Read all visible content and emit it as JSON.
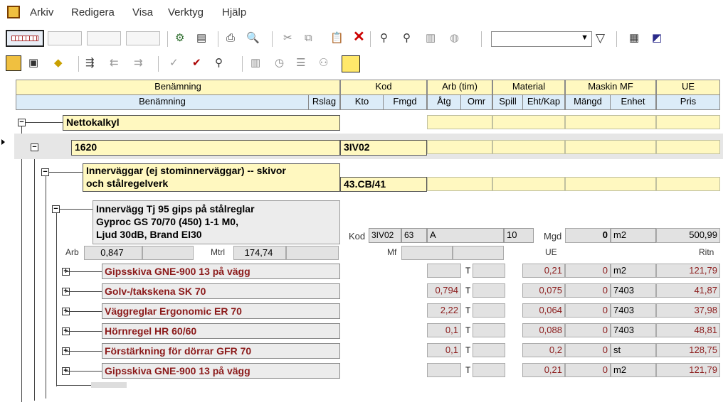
{
  "menu": {
    "items": [
      "Arkiv",
      "Redigera",
      "Visa",
      "Verktyg",
      "Hjälp"
    ]
  },
  "toolbar": {
    "combo_value": ""
  },
  "grid": {
    "group_headers": {
      "benamning": "Benämning",
      "kod": "Kod",
      "arb": "Arb (tim)",
      "material": "Material",
      "maskin": "Maskin MF",
      "ue": "UE"
    },
    "col_headers": {
      "benamning": "Benämning",
      "rslag": "Rslag",
      "kto": "Kto",
      "fmgd": "Fmgd",
      "atg": "Åtg",
      "omr": "Omr",
      "spill": "Spill",
      "eht": "Eht/Kap",
      "mangd": "Mängd",
      "enhet": "Enhet",
      "pris": "Pris"
    }
  },
  "tree": {
    "nettokalkyl": "Nettokalkyl",
    "n1620": {
      "label": "1620",
      "kod": "3IV02"
    },
    "innervaggar": {
      "label_line1": "Innerväggar (ej stominnerväggar) -- skivor",
      "label_line2": "och stålregelverk",
      "kod": "43.CB/41"
    },
    "detail": {
      "title_line1": "Innervägg Tj 95 gips på stålreglar",
      "title_line2": "Gyproc GS 70/70 (450) 1-1 M0,",
      "title_line3": "Ljud 30dB, Brand EI30",
      "kod_label": "Kod",
      "kod_val": "3IV02",
      "kod_num": "63",
      "a_val": "A",
      "ten_val": "10",
      "mgd_label": "Mgd",
      "mgd_val": "0",
      "unit": "m2",
      "pris": "500,99",
      "arb_label": "Arb",
      "arb_val": "0,847",
      "mtrl_label": "Mtrl",
      "mtrl_val": "174,74",
      "mf_label": "Mf",
      "ue_label": "UE",
      "ritn_label": "Ritn"
    },
    "items": [
      {
        "label": "Gipsskiva GNE-900 13 på vägg",
        "atg": "",
        "t": "T",
        "eht": "0,21",
        "mangd": "0",
        "enhet": "m2",
        "pris": "121,79"
      },
      {
        "label": "Golv-/takskena SK 70",
        "atg": "0,794",
        "t": "T",
        "eht": "0,075",
        "mangd": "0",
        "enhet": "7403",
        "pris": "41,87"
      },
      {
        "label": "Väggreglar Ergonomic ER 70",
        "atg": "2,22",
        "t": "T",
        "eht": "0,064",
        "mangd": "0",
        "enhet": "7403",
        "pris": "37,98"
      },
      {
        "label": "Hörnregel HR 60/60",
        "atg": "0,1",
        "t": "T",
        "eht": "0,088",
        "mangd": "0",
        "enhet": "7403",
        "pris": "48,81"
      },
      {
        "label": "Förstärkning för dörrar GFR 70",
        "atg": "0,1",
        "t": "T",
        "eht": "0,2",
        "mangd": "0",
        "enhet": "st",
        "pris": "128,75"
      },
      {
        "label": "Gipsskiva GNE-900 13 på vägg",
        "atg": "",
        "t": "T",
        "eht": "0,21",
        "mangd": "0",
        "enhet": "m2",
        "pris": "121,79"
      }
    ]
  }
}
